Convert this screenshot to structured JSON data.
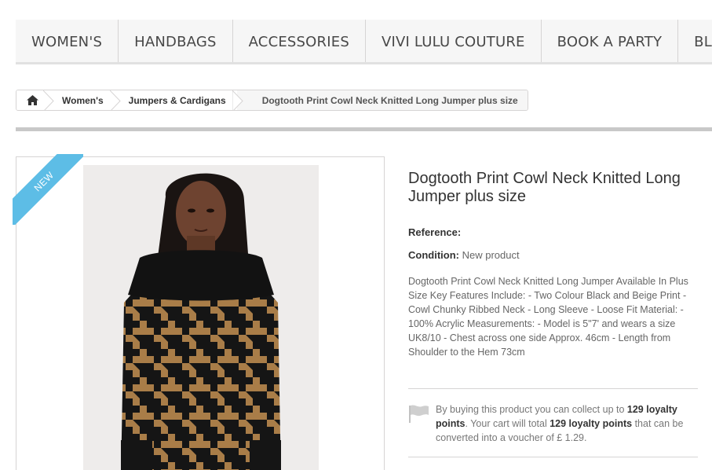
{
  "nav": {
    "items": [
      "WOMEN'S",
      "HANDBAGS",
      "ACCESSORIES",
      "VIVI LULU COUTURE",
      "BOOK A PARTY",
      "BLOG"
    ]
  },
  "breadcrumb": {
    "home_icon": "home-icon",
    "items": [
      "Women's",
      "Jumpers & Cardigans"
    ],
    "current": "Dogtooth Print Cowl Neck Knitted Long Jumper plus size"
  },
  "badge": {
    "label": "NEW",
    "color": "#5dbde6"
  },
  "product": {
    "title": "Dogtooth Print Cowl Neck Knitted Long Jumper plus size",
    "reference_label": "Reference:",
    "condition_label": "Condition:",
    "condition_value": "New product",
    "description": "Dogtooth Print Cowl Neck Knitted Long Jumper Available In Plus Size Key Features Include: - Two Colour Black and Beige Print - Cowl Chunky Ribbed Neck - Long Sleeve - Loose Fit Material: - 100% Acrylic Measurements: - Model is 5\"7' and wears a size UK8/10 - Chest across one side Approx. 46cm - Length from Shoulder to the Hem 73cm"
  },
  "loyalty": {
    "icon": "flag-icon",
    "text_1": "By buying this product you can collect up to ",
    "points_1": "129 loyalty points",
    "text_2": ". Your cart will total ",
    "points_2": "129 loyalty points",
    "text_3": " that can be converted into a voucher of £ 1.29."
  }
}
